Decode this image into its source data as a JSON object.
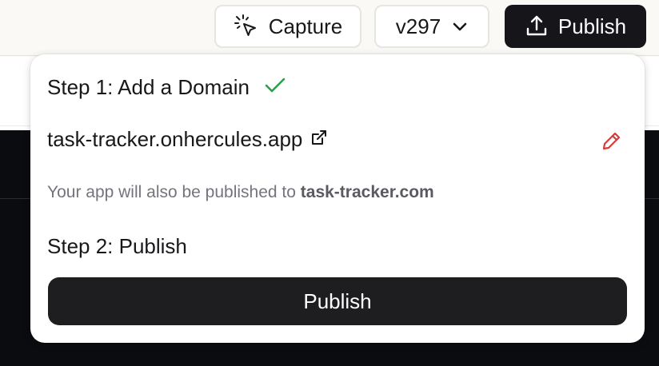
{
  "toolbar": {
    "capture_label": "Capture",
    "version_label": "v297",
    "publish_label": "Publish"
  },
  "popover": {
    "step1_title": "Step 1: Add a Domain",
    "domain": "task-tracker.onhercules.app",
    "note_prefix": "Your app will also be published to ",
    "note_domain": "task-tracker.com",
    "step2_title": "Step 2: Publish",
    "publish_button_label": "Publish"
  },
  "icons": {
    "capture": "cursor-click-icon",
    "version": "chevron-down-icon",
    "publish": "upload-icon",
    "step1_status": "check-icon",
    "domain_link": "external-link-icon",
    "edit": "pencil-icon"
  },
  "colors": {
    "check": "#2e9e4f",
    "pencil": "#d23c3c",
    "dark_button": "#16161a"
  }
}
